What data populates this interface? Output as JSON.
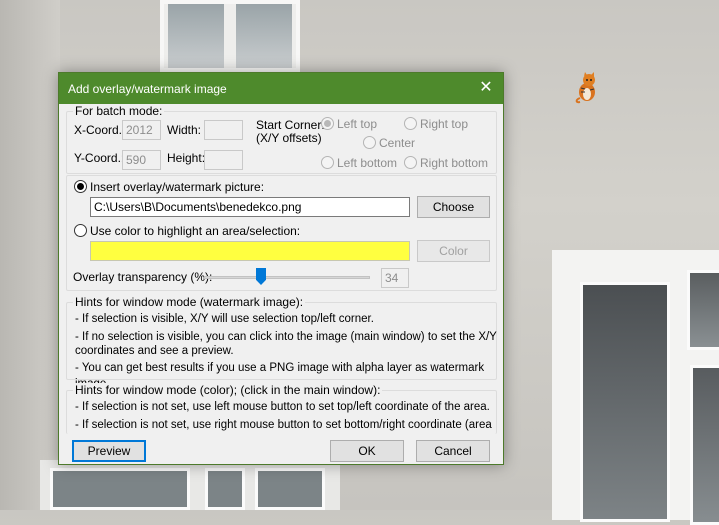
{
  "dialog": {
    "title": "Add overlay/watermark image",
    "close_symbol": "✕",
    "batch": {
      "legend": "For batch mode:",
      "x_label": "X-Coord.:",
      "x_value": "2012",
      "y_label": "Y-Coord.:",
      "y_value": "590",
      "width_label": "Width:",
      "height_label": "Height:",
      "start_corner_label": "Start Corner:",
      "start_corner_sub": "(X/Y offsets)",
      "corners": {
        "left_top": "Left top",
        "right_top": "Right top",
        "center": "Center",
        "left_bottom": "Left bottom",
        "right_bottom": "Right bottom"
      }
    },
    "insert_label": "Insert overlay/watermark picture:",
    "path_value": "C:\\Users\\B\\Documents\\benedekco.png",
    "choose_button": "Choose",
    "color_label": "Use color to highlight an area/selection:",
    "highlight_color": "#ffff40",
    "color_button": "Color",
    "transparency_label": "Overlay transparency (%):",
    "transparency_value": "34",
    "hints_image": {
      "legend": "Hints for window mode (watermark image):",
      "lines": [
        "- If selection is visible, X/Y will use selection top/left corner.",
        "- If no selection is visible, you can click into the image (main window) to set the X/Y",
        "coordinates and see a preview.",
        "- You can get best results if you use a PNG image with alpha layer as watermark image."
      ]
    },
    "hints_color": {
      "legend": "Hints for window mode (color); (click in the main window):",
      "lines": [
        "- If selection is not set, use left mouse button to set top/left coordinate of the area.",
        "- If selection is not set, use right mouse button to set bottom/right coordinate (area"
      ]
    },
    "preview_button": "Preview",
    "ok_button": "OK",
    "cancel_button": "Cancel"
  },
  "colors": {
    "titlebar": "#4e8a2c",
    "accent": "#0078d7"
  }
}
